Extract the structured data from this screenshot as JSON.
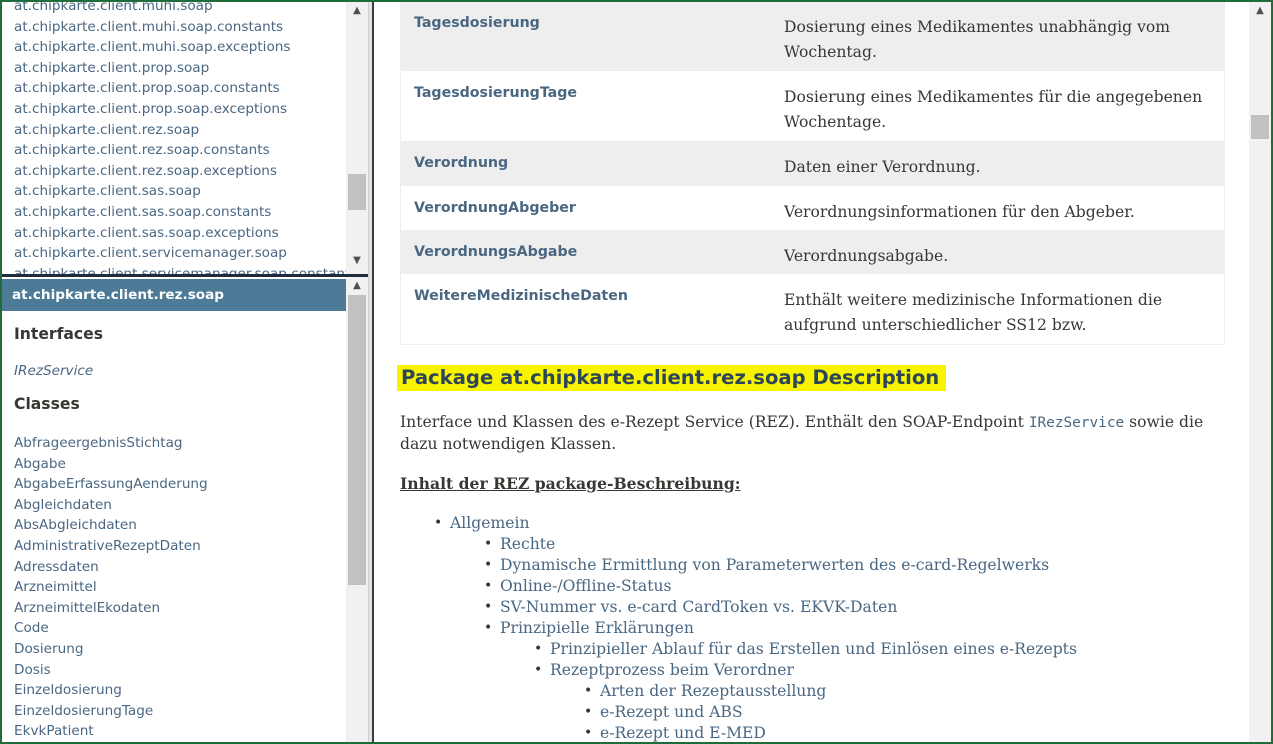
{
  "packages": [
    "at.chipkarte.client.muhi.soap",
    "at.chipkarte.client.muhi.soap.constants",
    "at.chipkarte.client.muhi.soap.exceptions",
    "at.chipkarte.client.prop.soap",
    "at.chipkarte.client.prop.soap.constants",
    "at.chipkarte.client.prop.soap.exceptions",
    "at.chipkarte.client.rez.soap",
    "at.chipkarte.client.rez.soap.constants",
    "at.chipkarte.client.rez.soap.exceptions",
    "at.chipkarte.client.sas.soap",
    "at.chipkarte.client.sas.soap.constants",
    "at.chipkarte.client.sas.soap.exceptions",
    "at.chipkarte.client.servicemanager.soap",
    "at.chipkarte.client.servicemanager.soap.constants"
  ],
  "class_frame": {
    "header": "at.chipkarte.client.rez.soap",
    "interfaces_title": "Interfaces",
    "interfaces": [
      "IRezService"
    ],
    "classes_title": "Classes",
    "classes": [
      "AbfrageergebnisStichtag",
      "Abgabe",
      "AbgabeErfassungAenderung",
      "Abgleichdaten",
      "AbsAbgleichdaten",
      "AdministrativeRezeptDaten",
      "Adressdaten",
      "Arzneimittel",
      "ArzneimittelEkodaten",
      "Code",
      "Dosierung",
      "Dosis",
      "Einzeldosierung",
      "EinzeldosierungTage",
      "EkvkPatient"
    ]
  },
  "summary_rows": [
    {
      "name": "Tagesdosierung",
      "desc": "Dosierung eines Medikamentes unabhängig vom Wochentag."
    },
    {
      "name": "TagesdosierungTage",
      "desc": "Dosierung eines Medikamentes für die angegebenen Wochentage."
    },
    {
      "name": "Verordnung",
      "desc": "Daten einer Verordnung."
    },
    {
      "name": "VerordnungAbgeber",
      "desc": "Verordnungsinformationen für den Abgeber."
    },
    {
      "name": "VerordnungsAbgabe",
      "desc": "Verordnungsabgabe."
    },
    {
      "name": "WeitereMedizinischeDaten",
      "desc": "Enthält weitere medizinische Informationen die aufgrund unterschiedlicher SS12 bzw."
    }
  ],
  "description": {
    "title": "Package at.chipkarte.client.rez.soap Description",
    "para_before": "Interface und Klassen des e-Rezept Service (REZ). Enthält den SOAP-Endpoint ",
    "para_code": "IRezService",
    "para_after": " sowie die dazu notwendigen Klassen.",
    "contents_heading": "Inhalt der REZ package-Beschreibung:"
  },
  "toc": [
    {
      "level": 1,
      "label": "Allgemein"
    },
    {
      "level": 2,
      "label": "Rechte"
    },
    {
      "level": 2,
      "label": "Dynamische Ermittlung von Parameterwerten des e-card-Regelwerks"
    },
    {
      "level": 2,
      "label": "Online-/Offline-Status"
    },
    {
      "level": 2,
      "label": "SV-Nummer vs. e-card CardToken vs. EKVK-Daten"
    },
    {
      "level": 2,
      "label": "Prinzipielle Erklärungen"
    },
    {
      "level": 3,
      "label": "Prinzipieller Ablauf für das Erstellen und Einlösen eines e-Rezepts"
    },
    {
      "level": 3,
      "label": "Rezeptprozess beim Verordner"
    },
    {
      "level": 4,
      "label": "Arten der Rezeptausstellung"
    },
    {
      "level": 4,
      "label": "e-Rezept und ABS"
    },
    {
      "level": 4,
      "label": "e-Rezept und E-MED"
    }
  ],
  "icons": {
    "scroll_up": "chevron-up-icon",
    "scroll_down": "chevron-down-icon"
  }
}
